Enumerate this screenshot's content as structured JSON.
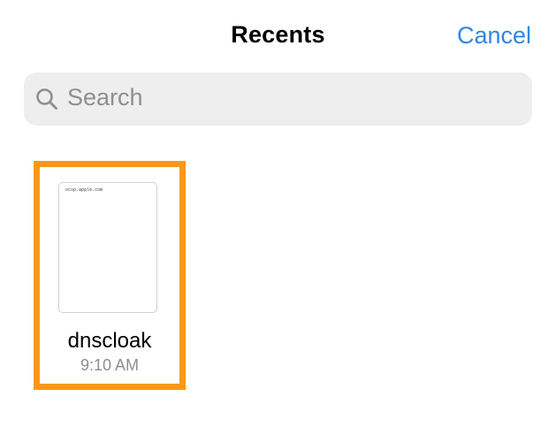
{
  "header": {
    "title": "Recents",
    "cancel_label": "Cancel"
  },
  "search": {
    "placeholder": "Search",
    "icon": "search-icon"
  },
  "files": [
    {
      "name": "dnscloak",
      "time": "9:10 AM",
      "preview_text": "ocsp.apple.com",
      "selected": true
    }
  ],
  "colors": {
    "accent": "#2f86e3",
    "selection": "#f7981c",
    "search_background": "#eeeeef",
    "secondary_text": "#8e8e93"
  }
}
